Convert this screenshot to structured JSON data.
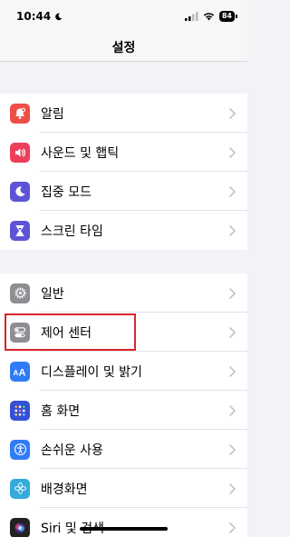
{
  "status": {
    "time": "10:44",
    "battery": "84"
  },
  "header": {
    "title": "설정"
  },
  "groups": [
    {
      "items": [
        {
          "label": "알림",
          "icon": "bell-icon",
          "color": "#ef4e47"
        },
        {
          "label": "사운드 및 햅틱",
          "icon": "speaker-icon",
          "color": "#ee3e5b"
        },
        {
          "label": "집중 모드",
          "icon": "moon-icon",
          "color": "#5b55d6"
        },
        {
          "label": "스크린 타임",
          "icon": "hourglass-icon",
          "color": "#5b55d6"
        }
      ]
    },
    {
      "items": [
        {
          "label": "일반",
          "icon": "gear-icon",
          "color": "#8e8e93"
        },
        {
          "label": "제어 센터",
          "icon": "toggles-icon",
          "color": "#8e8e93"
        },
        {
          "label": "디스플레이 및 밝기",
          "icon": "text-size-icon",
          "color": "#2f7cf6"
        },
        {
          "label": "홈 화면",
          "icon": "grid-icon",
          "color": "#3550d6"
        },
        {
          "label": "손쉬운 사용",
          "icon": "accessibility-icon",
          "color": "#2f7cf6"
        },
        {
          "label": "배경화면",
          "icon": "flower-icon",
          "color": "#35aadc"
        },
        {
          "label": "Siri 및 검색",
          "icon": "siri-icon",
          "color": "#222222"
        }
      ]
    }
  ]
}
